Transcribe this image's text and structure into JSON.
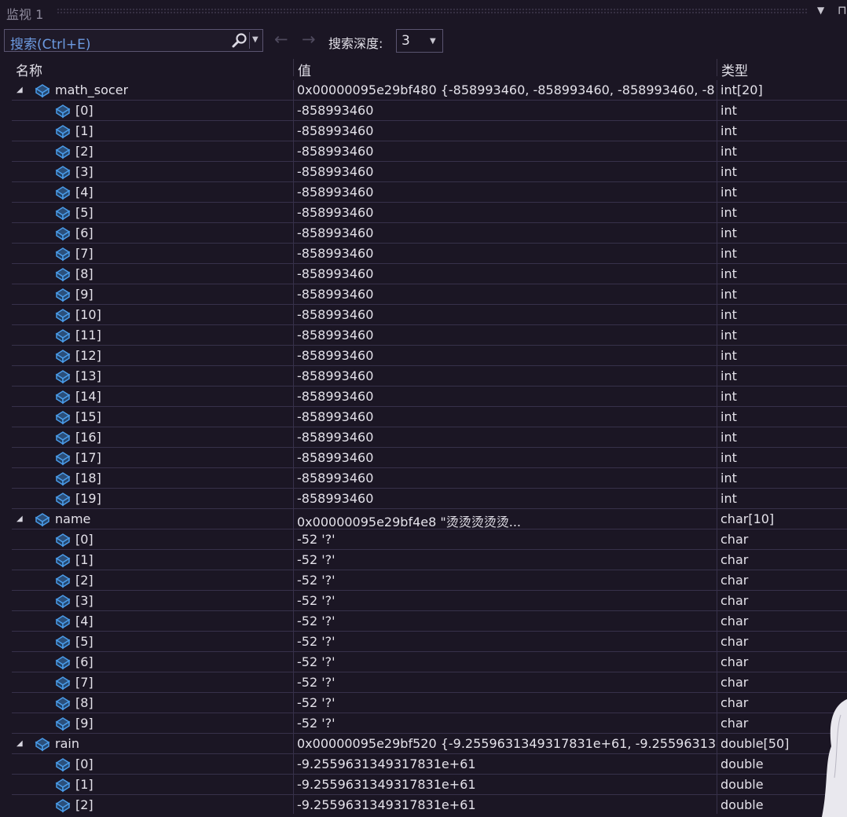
{
  "window": {
    "title": "监视 1",
    "dropdown_icon": "dropdown-arrow-icon",
    "pin_icon": "pin-icon"
  },
  "toolbar": {
    "search_placeholder": "搜索(Ctrl+E)",
    "depth_label": "搜索深度:",
    "depth_value": "3",
    "back_icon": "back-arrow-icon",
    "forward_icon": "forward-arrow-icon"
  },
  "columns": {
    "name": "名称",
    "value": "值",
    "type": "类型"
  },
  "rows": [
    {
      "level": 0,
      "expanded": true,
      "name": "math_socer",
      "value": "0x00000095e29bf480 {-858993460, -858993460, -858993460, -8...",
      "type": "int[20]"
    },
    {
      "level": 1,
      "name": "[0]",
      "value": "-858993460",
      "type": "int"
    },
    {
      "level": 1,
      "name": "[1]",
      "value": "-858993460",
      "type": "int"
    },
    {
      "level": 1,
      "name": "[2]",
      "value": "-858993460",
      "type": "int"
    },
    {
      "level": 1,
      "name": "[3]",
      "value": "-858993460",
      "type": "int"
    },
    {
      "level": 1,
      "name": "[4]",
      "value": "-858993460",
      "type": "int"
    },
    {
      "level": 1,
      "name": "[5]",
      "value": "-858993460",
      "type": "int"
    },
    {
      "level": 1,
      "name": "[6]",
      "value": "-858993460",
      "type": "int"
    },
    {
      "level": 1,
      "name": "[7]",
      "value": "-858993460",
      "type": "int"
    },
    {
      "level": 1,
      "name": "[8]",
      "value": "-858993460",
      "type": "int"
    },
    {
      "level": 1,
      "name": "[9]",
      "value": "-858993460",
      "type": "int"
    },
    {
      "level": 1,
      "name": "[10]",
      "value": "-858993460",
      "type": "int"
    },
    {
      "level": 1,
      "name": "[11]",
      "value": "-858993460",
      "type": "int"
    },
    {
      "level": 1,
      "name": "[12]",
      "value": "-858993460",
      "type": "int"
    },
    {
      "level": 1,
      "name": "[13]",
      "value": "-858993460",
      "type": "int"
    },
    {
      "level": 1,
      "name": "[14]",
      "value": "-858993460",
      "type": "int"
    },
    {
      "level": 1,
      "name": "[15]",
      "value": "-858993460",
      "type": "int"
    },
    {
      "level": 1,
      "name": "[16]",
      "value": "-858993460",
      "type": "int"
    },
    {
      "level": 1,
      "name": "[17]",
      "value": "-858993460",
      "type": "int"
    },
    {
      "level": 1,
      "name": "[18]",
      "value": "-858993460",
      "type": "int"
    },
    {
      "level": 1,
      "name": "[19]",
      "value": "-858993460",
      "type": "int"
    },
    {
      "level": 0,
      "expanded": true,
      "name": "name",
      "value": "0x00000095e29bf4e8 \"烫烫烫烫烫...",
      "type": "char[10]"
    },
    {
      "level": 1,
      "name": "[0]",
      "value": "-52 '?'",
      "type": "char"
    },
    {
      "level": 1,
      "name": "[1]",
      "value": "-52 '?'",
      "type": "char"
    },
    {
      "level": 1,
      "name": "[2]",
      "value": "-52 '?'",
      "type": "char"
    },
    {
      "level": 1,
      "name": "[3]",
      "value": "-52 '?'",
      "type": "char"
    },
    {
      "level": 1,
      "name": "[4]",
      "value": "-52 '?'",
      "type": "char"
    },
    {
      "level": 1,
      "name": "[5]",
      "value": "-52 '?'",
      "type": "char"
    },
    {
      "level": 1,
      "name": "[6]",
      "value": "-52 '?'",
      "type": "char"
    },
    {
      "level": 1,
      "name": "[7]",
      "value": "-52 '?'",
      "type": "char"
    },
    {
      "level": 1,
      "name": "[8]",
      "value": "-52 '?'",
      "type": "char"
    },
    {
      "level": 1,
      "name": "[9]",
      "value": "-52 '?'",
      "type": "char"
    },
    {
      "level": 0,
      "expanded": true,
      "name": "rain",
      "value": "0x00000095e29bf520 {-9.2559631349317831e+61, -9.25596313...",
      "type": "double[50]"
    },
    {
      "level": 1,
      "name": "[0]",
      "value": "-9.2559631349317831e+61",
      "type": "double"
    },
    {
      "level": 1,
      "name": "[1]",
      "value": "-9.2559631349317831e+61",
      "type": "double"
    },
    {
      "level": 1,
      "name": "[2]",
      "value": "-9.2559631349317831e+61",
      "type": "double"
    }
  ],
  "colors": {
    "background": "#1b1624",
    "search_text": "#6c9ae0",
    "grid_line": "#37314a",
    "icon_blue": "#4a9be8"
  }
}
